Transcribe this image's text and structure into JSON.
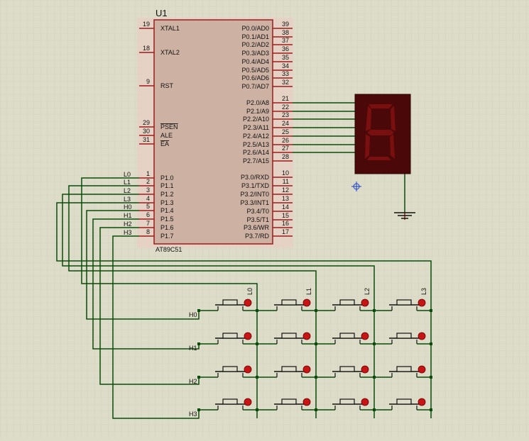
{
  "chip": {
    "designator": "U1",
    "part": "AT89C51",
    "left_pins": [
      {
        "num": "19",
        "name": "XTAL1"
      },
      {
        "num": "18",
        "name": "XTAL2"
      },
      {
        "num": "9",
        "name": "RST"
      },
      {
        "num": "29",
        "name": "PSEN"
      },
      {
        "num": "30",
        "name": "ALE"
      },
      {
        "num": "31",
        "name": "EA"
      },
      {
        "num": "1",
        "name": "P1.0"
      },
      {
        "num": "2",
        "name": "P1.1"
      },
      {
        "num": "3",
        "name": "P1.2"
      },
      {
        "num": "4",
        "name": "P1.3"
      },
      {
        "num": "5",
        "name": "P1.4"
      },
      {
        "num": "6",
        "name": "P1.5"
      },
      {
        "num": "7",
        "name": "P1.6"
      },
      {
        "num": "8",
        "name": "P1.7"
      }
    ],
    "right_pins": [
      {
        "num": "39",
        "name": "P0.0/AD0"
      },
      {
        "num": "38",
        "name": "P0.1/AD1"
      },
      {
        "num": "37",
        "name": "P0.2/AD2"
      },
      {
        "num": "36",
        "name": "P0.3/AD3"
      },
      {
        "num": "35",
        "name": "P0.4/AD4"
      },
      {
        "num": "34",
        "name": "P0.5/AD5"
      },
      {
        "num": "33",
        "name": "P0.6/AD6"
      },
      {
        "num": "32",
        "name": "P0.7/AD7"
      },
      {
        "num": "21",
        "name": "P2.0/A8"
      },
      {
        "num": "22",
        "name": "P2.1/A9"
      },
      {
        "num": "23",
        "name": "P2.2/A10"
      },
      {
        "num": "24",
        "name": "P2.3/A11"
      },
      {
        "num": "25",
        "name": "P2.4/A12"
      },
      {
        "num": "26",
        "name": "P2.5/A13"
      },
      {
        "num": "27",
        "name": "P2.6/A14"
      },
      {
        "num": "28",
        "name": "P2.7/A15"
      },
      {
        "num": "10",
        "name": "P3.0/RXD"
      },
      {
        "num": "11",
        "name": "P3.1/TXD"
      },
      {
        "num": "12",
        "name": "P3.2/INT0"
      },
      {
        "num": "13",
        "name": "P3.3/INT1"
      },
      {
        "num": "14",
        "name": "P3.4/T0"
      },
      {
        "num": "15",
        "name": "P3.5/T1"
      },
      {
        "num": "16",
        "name": "P3.6/WR"
      },
      {
        "num": "17",
        "name": "P3.7/RD"
      }
    ]
  },
  "net_labels": {
    "port1": [
      "L0",
      "L1",
      "L2",
      "L3",
      "H0",
      "H1",
      "H2",
      "H3"
    ],
    "columns": [
      "L0",
      "L1",
      "L2",
      "L3"
    ],
    "rows": [
      "H0",
      "H1",
      "H2",
      "H3"
    ]
  },
  "colors": {
    "background": "#dcdcc9",
    "grid": "#c6c6b2",
    "chip_body": "#cfb0a2",
    "chip_outline": "#9a1d1d",
    "wire": "#0b4d0b",
    "display_body": "#4a0808",
    "display_segment": "#7a0f0f",
    "button_red": "#c81414"
  },
  "icons": [
    "seven-segment-display-icon",
    "ground-icon",
    "push-button-icon",
    "origin-marker-icon"
  ]
}
